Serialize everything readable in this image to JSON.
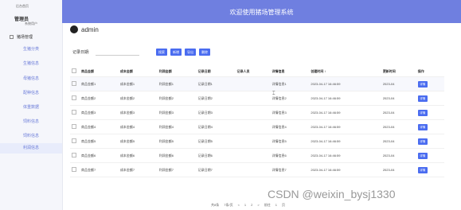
{
  "sidebar": {
    "app_title": "后台首页",
    "user_name": "管理员",
    "user_role": "系统用户",
    "group_label": "猪场管理",
    "items": [
      {
        "label": "生猪分类"
      },
      {
        "label": "生猪信息"
      },
      {
        "label": "母猪信息"
      },
      {
        "label": "配种信息"
      },
      {
        "label": "体重数据"
      },
      {
        "label": "饲料信息"
      },
      {
        "label": "饲料信息"
      },
      {
        "label": "利润信息"
      }
    ],
    "active_index": 7
  },
  "header": {
    "title": "欢迎使用猪场管理系统"
  },
  "breadcrumb": {
    "text": "admin"
  },
  "filter": {
    "label": "记录日期:",
    "placeholder": ""
  },
  "toolbar": {
    "search": "搜索",
    "add": "新增",
    "export": "导出",
    "delete": "删除"
  },
  "table": {
    "headers": [
      "商品金额",
      "成本金额",
      "利润金额",
      "记录日期",
      "记录人员",
      "详情信息",
      "创建时间 ↕",
      "更新时间",
      "操作"
    ],
    "rows": [
      [
        "商品金额1",
        "成本金额1",
        "利润金额1",
        "记录日期1",
        "",
        "详情信息1",
        "2023-04-17 16:46:59",
        "2023-04",
        "详情"
      ],
      [
        "商品金额2",
        "成本金额2",
        "利润金额2",
        "记录日期2",
        "",
        "详情信息2",
        "2023-04-17 16:46:59",
        "2023-04",
        "详情"
      ],
      [
        "商品金额3",
        "成本金额3",
        "利润金额3",
        "记录日期3",
        "",
        "详情信息3",
        "2023-04-17 16:46:59",
        "2023-04",
        "详情"
      ],
      [
        "商品金额4",
        "成本金额4",
        "利润金额4",
        "记录日期4",
        "",
        "详情信息4",
        "2023-04-17 16:46:59",
        "2023-04",
        "详情"
      ],
      [
        "商品金额5",
        "成本金额5",
        "利润金额5",
        "记录日期5",
        "",
        "详情信息5",
        "2023-04-17 16:46:59",
        "2023-04",
        "详情"
      ],
      [
        "商品金额6",
        "成本金额6",
        "利润金额6",
        "记录日期6",
        "",
        "详情信息6",
        "2023-04-17 16:46:59",
        "2023-04",
        "详情"
      ],
      [
        "商品金额7",
        "成本金额7",
        "利润金额7",
        "记录日期7",
        "",
        "详情信息7",
        "2023-04-17 16:46:59",
        "2023-04",
        "详情"
      ]
    ]
  },
  "pager": {
    "total": "共8条",
    "per": "7条/页",
    "prev": "<",
    "p1": "1",
    "p2": "2",
    "next": ">",
    "goto": "前往",
    "page": "1",
    "unit": "页"
  },
  "watermark": "CSDN @weixin_bysj1330",
  "colors": {
    "accent": "#6f7fe0",
    "button": "#4a6cf0"
  }
}
